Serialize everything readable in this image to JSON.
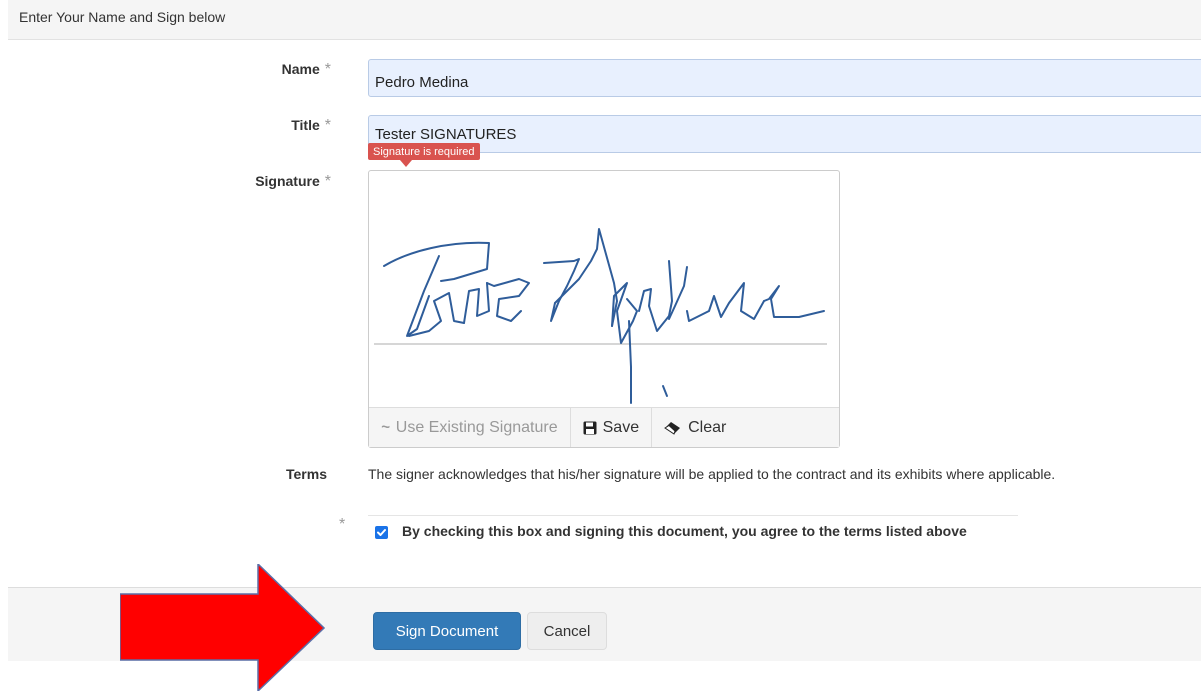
{
  "header": {
    "title": "Enter Your Name and Sign below"
  },
  "form": {
    "name": {
      "label": "Name",
      "required": "*",
      "value": "Pedro Medina"
    },
    "title": {
      "label": "Title",
      "required": "*",
      "value": "Tester SIGNATURES"
    },
    "signature": {
      "label": "Signature",
      "required": "*",
      "error": "Signature is required",
      "toolbar": {
        "use_existing": "Use Existing Signature",
        "save": "Save",
        "clear": "Clear"
      }
    },
    "terms": {
      "label": "Terms",
      "text": "The signer acknowledges that his/her signature will be applied to the contract and its exhibits where applicable."
    },
    "agree": {
      "required": "*",
      "label": "By checking this box and signing this document, you agree to the terms listed above",
      "checked": true
    }
  },
  "footer": {
    "sign_label": "Sign Document",
    "cancel_label": "Cancel"
  },
  "colors": {
    "primary": "#337ab7",
    "error": "#d9534f",
    "input_bg": "#e8f0fe",
    "annotation_arrow": "#ff0000",
    "signature_ink": "#2f5d9a"
  },
  "icons": [
    "signature-icon",
    "save-icon",
    "eraser-icon",
    "check-icon",
    "arrow-right-icon"
  ]
}
